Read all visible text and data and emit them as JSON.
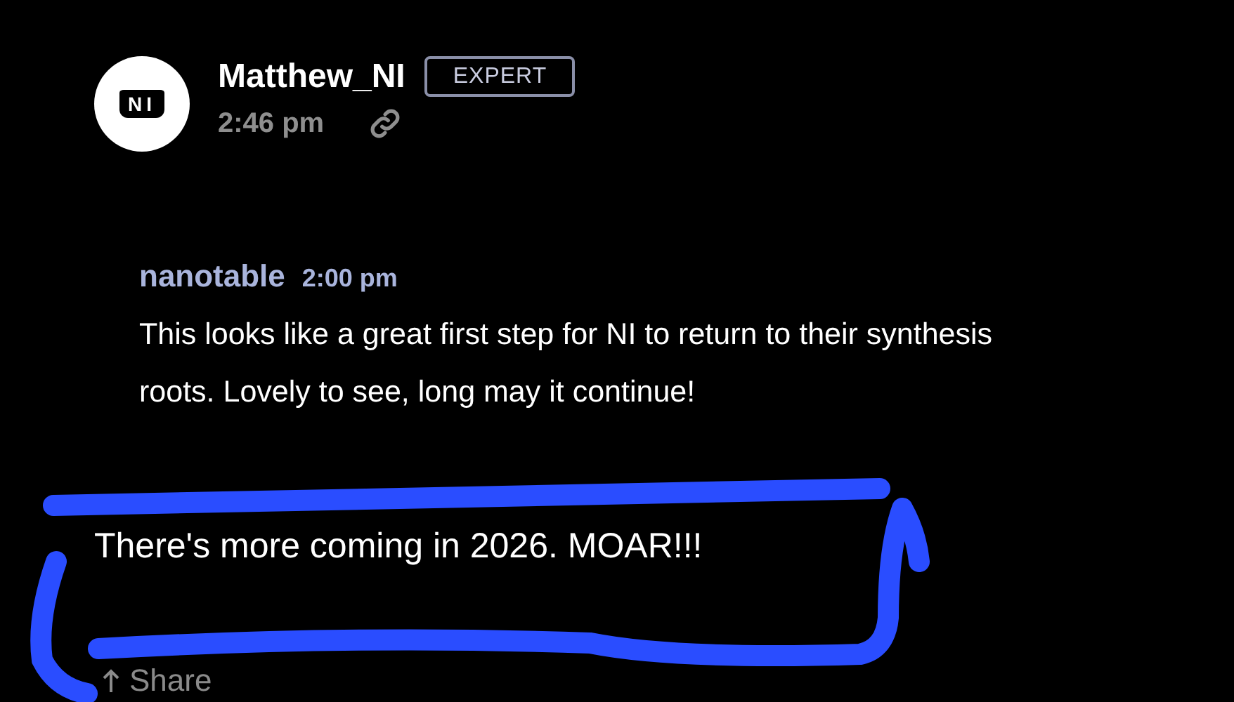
{
  "post": {
    "avatar_text": "NI",
    "author": "Matthew_NI",
    "badge": "EXPERT",
    "time": "2:46 pm"
  },
  "quote": {
    "author": "nanotable",
    "time": "2:00 pm",
    "text": "This looks like a great first step for NI to return to their synthesis roots. Lovely to see, long may it continue!"
  },
  "reply": {
    "text": "There's more coming in 2026. MOAR!!!"
  },
  "actions": [
    {
      "label": "Share"
    }
  ]
}
